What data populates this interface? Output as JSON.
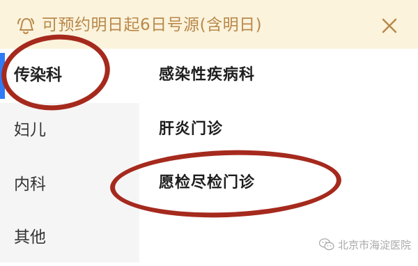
{
  "banner": {
    "notice": "可预约明日起6日号源(含明日)",
    "icon": "bell-icon",
    "close_icon": "close-icon",
    "text_color": "#b8884a",
    "background": "#fbf3dc"
  },
  "sidebar": {
    "items": [
      {
        "label": "传染科",
        "active": true
      },
      {
        "label": "妇儿",
        "active": false
      },
      {
        "label": "内科",
        "active": false
      },
      {
        "label": "其他",
        "active": false
      }
    ],
    "accent": "#2f7bf6"
  },
  "clinics": [
    {
      "label": "感染性疾病科"
    },
    {
      "label": "肝炎门诊"
    },
    {
      "label": "愿检尽检门诊"
    }
  ],
  "annotation_color": "#a52a1d",
  "watermark": {
    "text": "北京市海淀医院",
    "icon": "wechat-icon"
  }
}
